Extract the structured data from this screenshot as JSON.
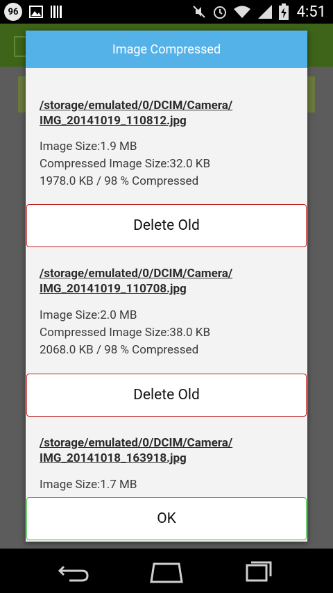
{
  "status_bar": {
    "badge": "96",
    "time": "4:51",
    "icons": [
      "notification-count-icon",
      "image-icon",
      "barcode-icon",
      "mute-icon",
      "alarm-icon",
      "wifi-icon",
      "signal-icon",
      "battery-charging-icon"
    ]
  },
  "dialog": {
    "title": "Image Compressed",
    "entries": [
      {
        "path_line1": "/storage/emulated/0/DCIM/Camera/",
        "path_line2": "IMG_20141019_110812.jpg",
        "image_size": "Image Size:1.9 MB",
        "compressed_size": "Compressed Image Size:32.0 KB",
        "summary": "1978.0 KB / 98 % Compressed",
        "delete_label": "Delete Old"
      },
      {
        "path_line1": "/storage/emulated/0/DCIM/Camera/",
        "path_line2": "IMG_20141019_110708.jpg",
        "image_size": "Image Size:2.0 MB",
        "compressed_size": "Compressed Image Size:38.0 KB",
        "summary": "2068.0 KB / 98 % Compressed",
        "delete_label": "Delete Old"
      },
      {
        "path_line1": "/storage/emulated/0/DCIM/Camera/",
        "path_line2": "IMG_20141018_163918.jpg",
        "image_size": "Image Size:1.7 MB"
      }
    ],
    "ok_label": "OK"
  },
  "colors": {
    "title_bar": "#55b2e8",
    "delete_border": "#c02020",
    "ok_border": "#3bbf3b",
    "app_bar": "#3d6418"
  }
}
